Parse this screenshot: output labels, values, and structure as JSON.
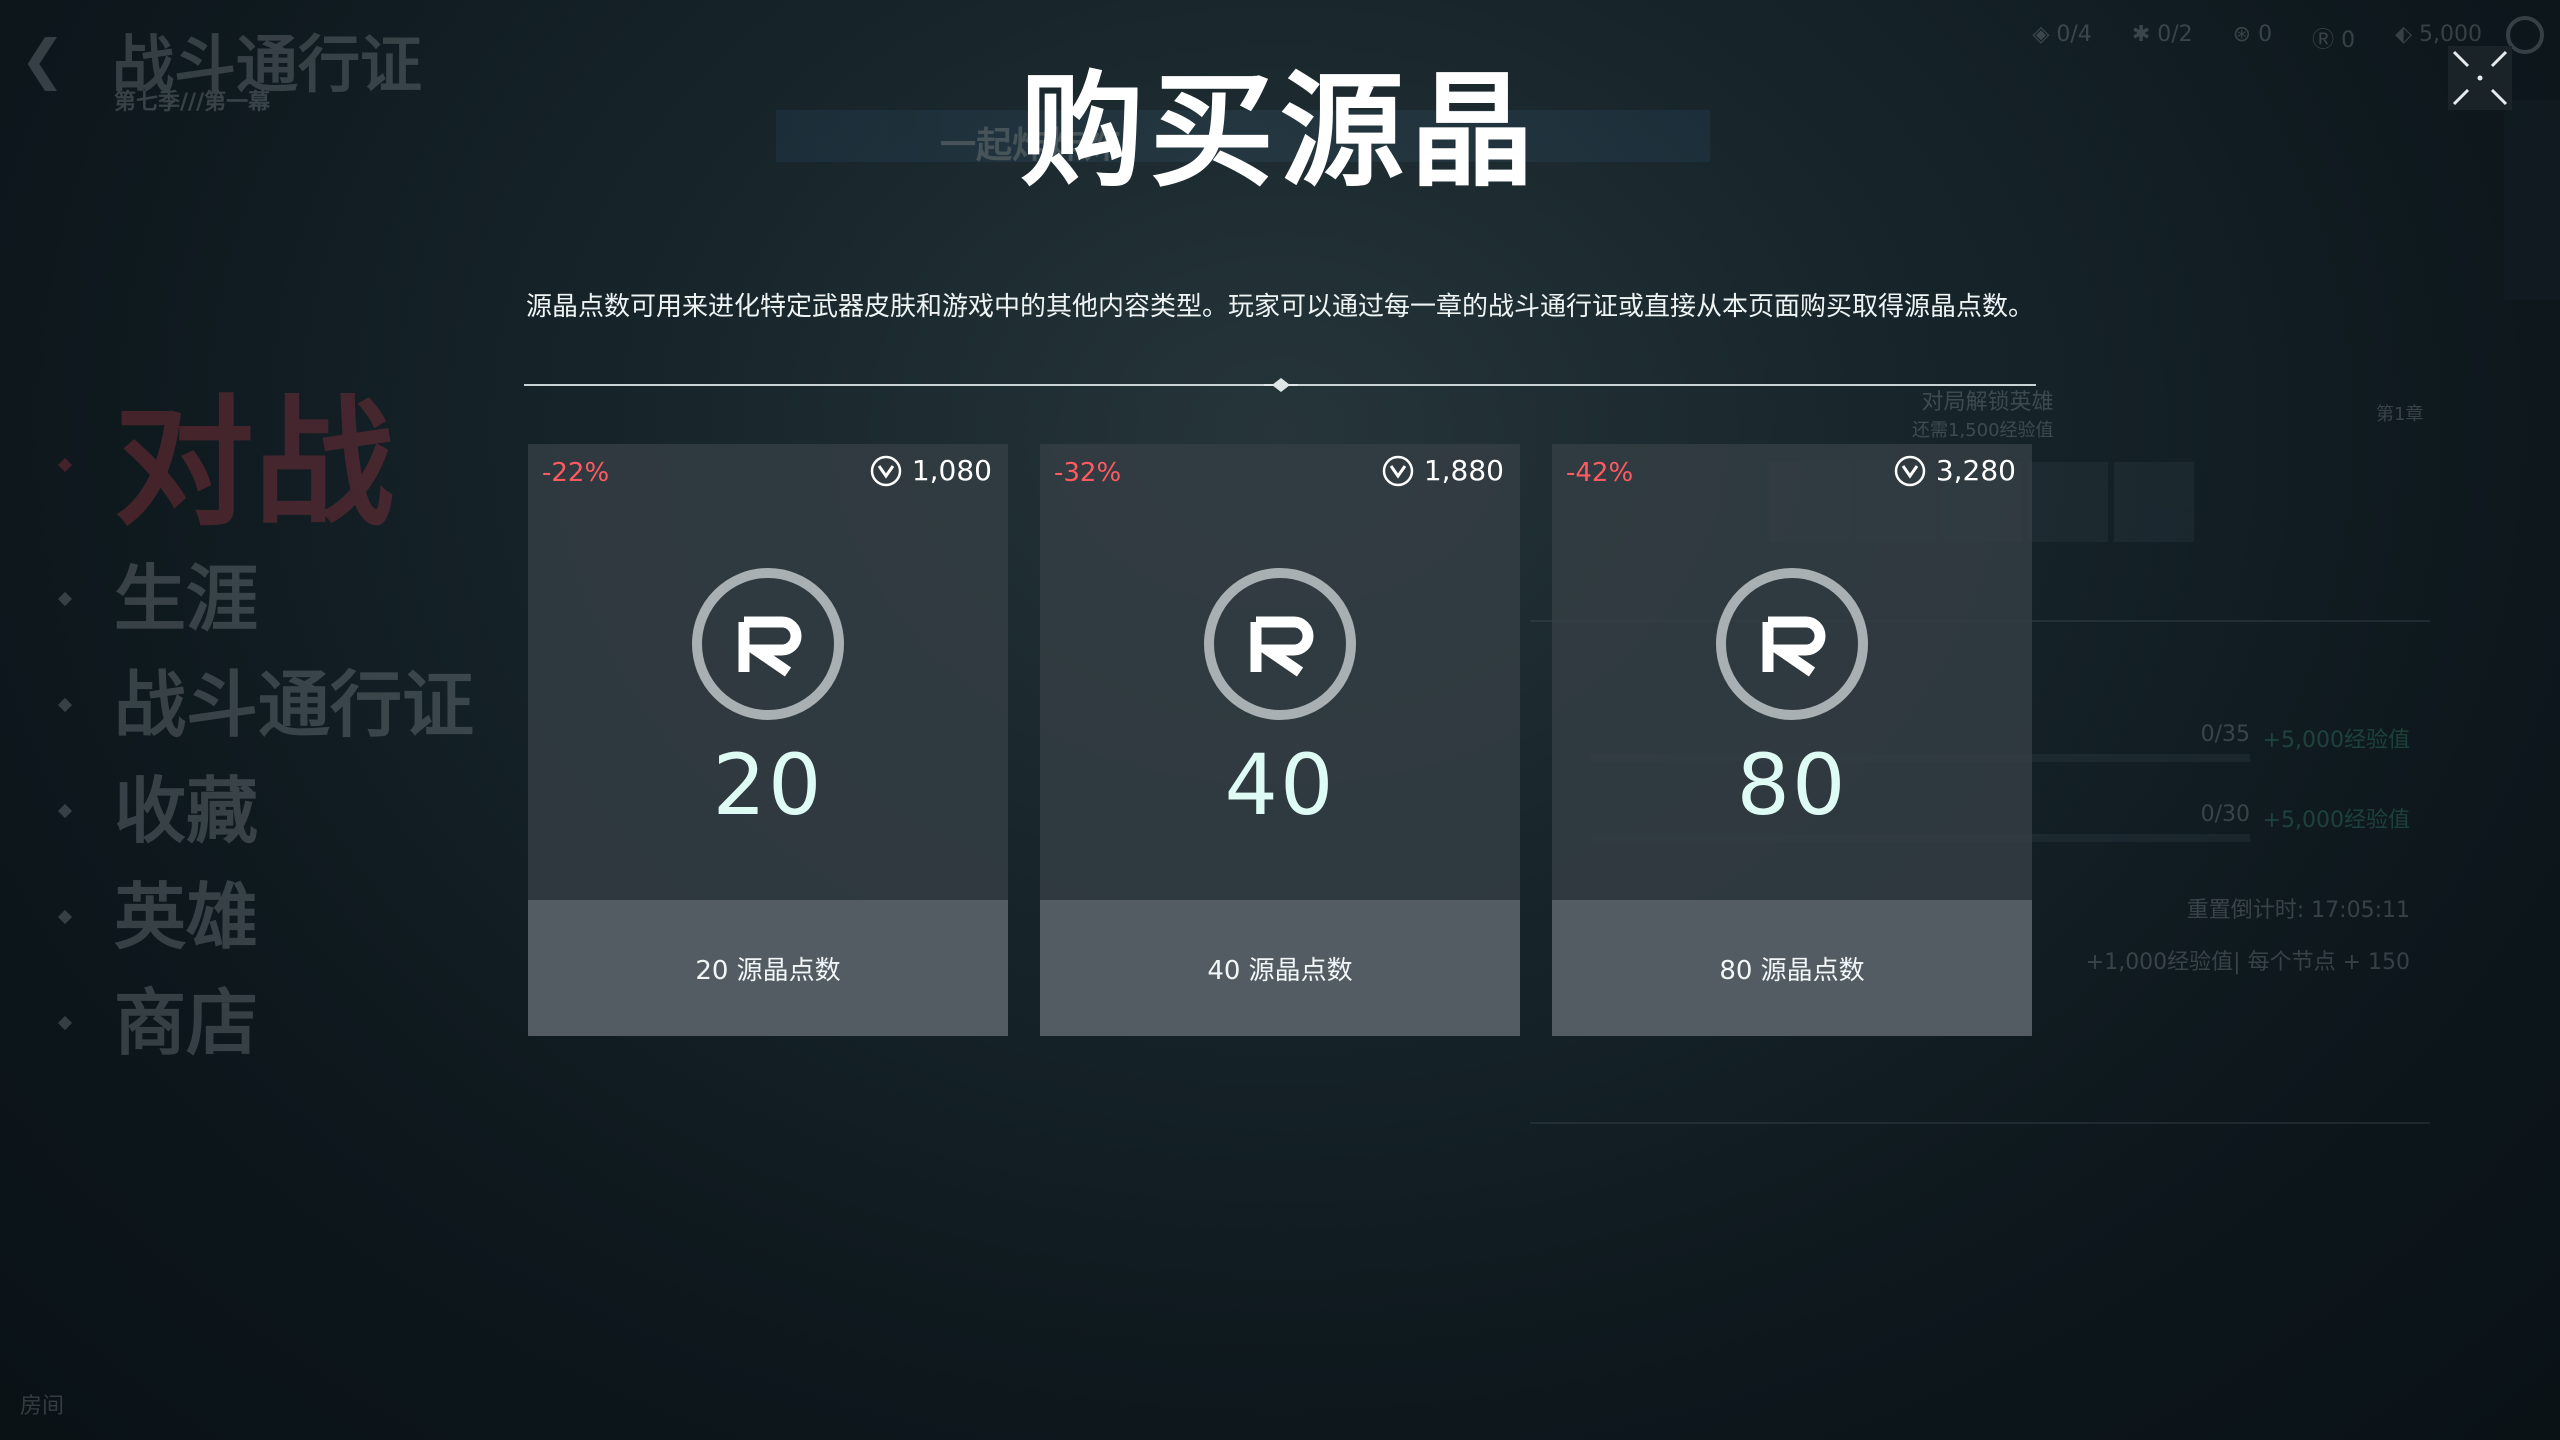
{
  "background": {
    "back_glyph": "❮",
    "title": "战斗通行证",
    "subtitle": "第七季///第一幕",
    "banner_text": "一起炸炸炸",
    "top_stats": [
      "◈ 0/4",
      "✱ 0/2",
      "⊛ 0",
      "Ⓡ 0",
      "⬖ 5,000"
    ],
    "menu": [
      {
        "label": "对战",
        "active": true
      },
      {
        "label": "生涯",
        "active": false
      },
      {
        "label": "战斗通行证",
        "active": false
      },
      {
        "label": "收藏",
        "active": false
      },
      {
        "label": "英雄",
        "active": false
      },
      {
        "label": "商店",
        "active": false
      }
    ],
    "right_header": "对局解锁英雄",
    "right_header_sub": "还需1,500经验值",
    "chapter_label": "第1章",
    "rows": [
      {
        "label": "",
        "progress": "0/35",
        "xp": "+5,000经验值"
      },
      {
        "label": "",
        "progress": "0/30",
        "xp": "+5,000经验值"
      }
    ],
    "reset_label": "重置倒计时: 17:05:11",
    "node_label": "+1,000经验值| 每个节点 + 150",
    "bottom_left": "房间"
  },
  "modal": {
    "title": "购买源晶",
    "description": "源晶点数可用来进化特定武器皮肤和游戏中的其他内容类型。玩家可以通过每一章的战斗通行证或直接从本页面购买取得源晶点数。",
    "cards": [
      {
        "discount": "-22%",
        "price": "1,080",
        "amount": "20",
        "label": "20 源晶点数"
      },
      {
        "discount": "-32%",
        "price": "1,880",
        "amount": "40",
        "label": "40 源晶点数"
      },
      {
        "discount": "-42%",
        "price": "3,280",
        "amount": "80",
        "label": "80 源晶点数"
      }
    ]
  },
  "colors": {
    "discount": "#ff5a5f",
    "amount": "#dffcf4",
    "accent_red": "#ff4655"
  },
  "icons": {
    "close": "close-icon",
    "currency": "valorant-points-icon",
    "radianite": "radianite-icon"
  }
}
